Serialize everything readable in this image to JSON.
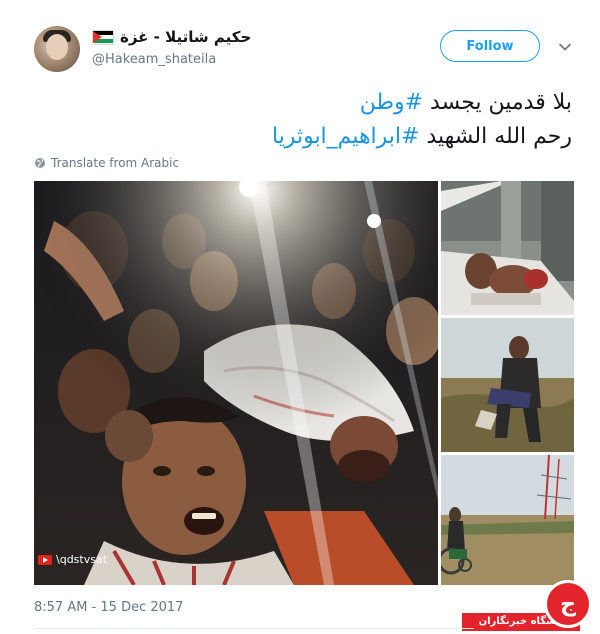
{
  "author": {
    "display_name": "حکیم شاتیلا - غزة",
    "handle": "@Hakeam_shateila",
    "avatar_icon": "user-avatar"
  },
  "follow_label": "Follow",
  "colors": {
    "accent": "#1da1f2",
    "hashtag": "#1b95e0",
    "muted": "#657786",
    "badge_red": "#e2242c"
  },
  "tweet": {
    "line1_text": "بلا قدمين يجسد ",
    "line1_hashtag": "#وطن",
    "line2_text": "رحم الله الشهيد ",
    "line2_hashtag": "#ابراهيم_ابوثريا"
  },
  "translate_label": "Translate from Arabic",
  "media": {
    "watermark": "\\qdstvsat"
  },
  "timestamp": "8:57 AM - 15 Dec 2017",
  "badge": {
    "label": "باشگاه خبرنگاران",
    "glyph": "ج"
  }
}
